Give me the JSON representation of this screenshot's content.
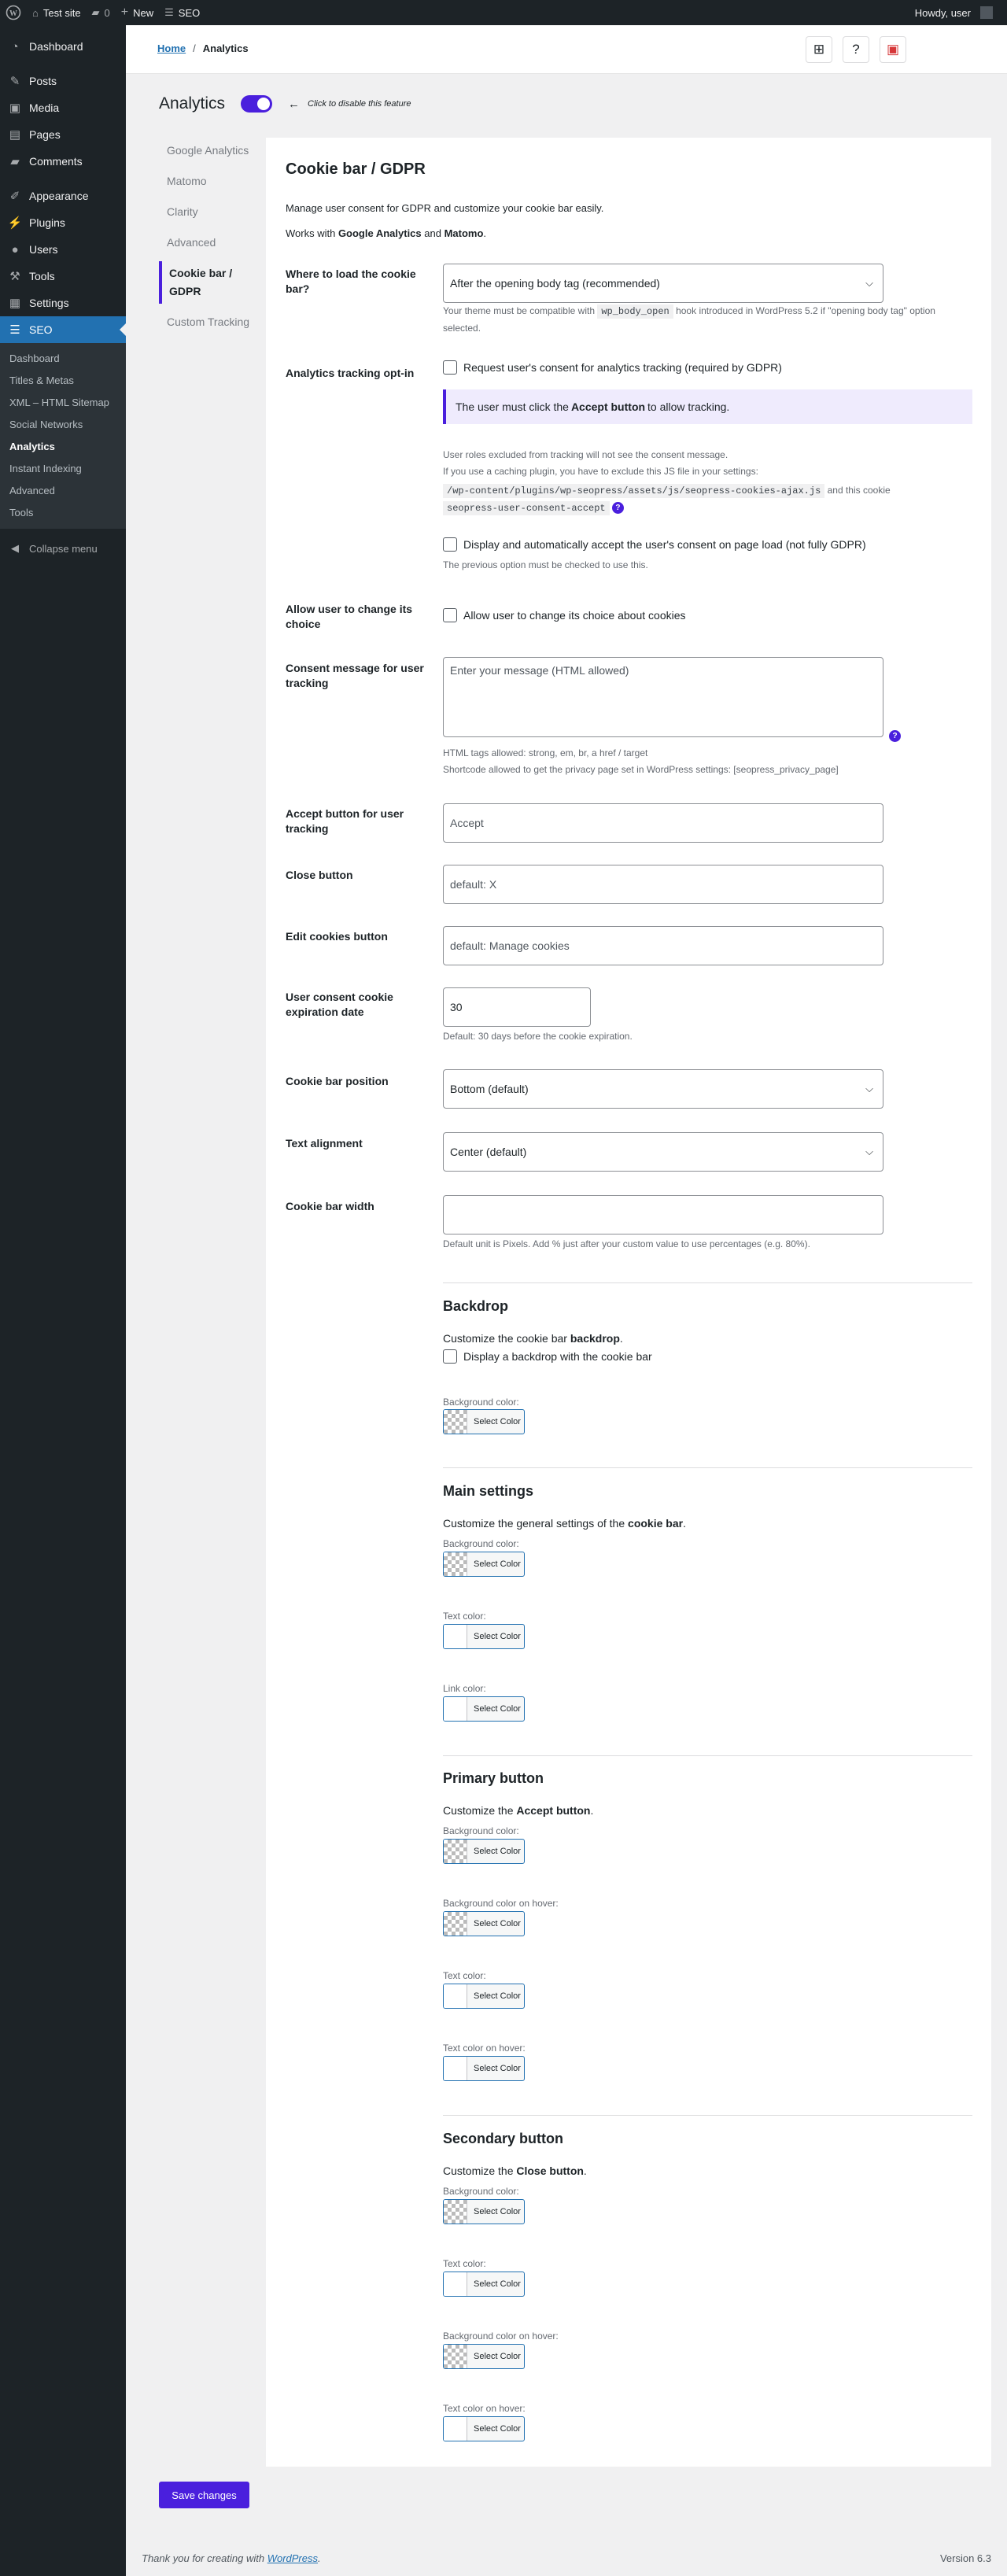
{
  "admin_bar": {
    "site_name": "Test site",
    "comments_count": "0",
    "new_label": "New",
    "seo_label": "SEO",
    "howdy": "Howdy, user"
  },
  "sidebar": {
    "items": [
      {
        "label": "Dashboard",
        "icon": "dashboard-icon"
      },
      {
        "label": "Posts",
        "icon": "pin-icon"
      },
      {
        "label": "Media",
        "icon": "media-icon"
      },
      {
        "label": "Pages",
        "icon": "page-icon"
      },
      {
        "label": "Comments",
        "icon": "comment-icon"
      },
      {
        "label": "Appearance",
        "icon": "brush-icon"
      },
      {
        "label": "Plugins",
        "icon": "plugin-icon"
      },
      {
        "label": "Users",
        "icon": "user-icon"
      },
      {
        "label": "Tools",
        "icon": "wrench-icon"
      },
      {
        "label": "Settings",
        "icon": "settings-icon"
      },
      {
        "label": "SEO",
        "icon": "seo-icon"
      }
    ],
    "seo_submenu": [
      "Dashboard",
      "Titles & Metas",
      "XML – HTML Sitemap",
      "Social Networks",
      "Analytics",
      "Instant Indexing",
      "Advanced",
      "Tools"
    ],
    "collapse": "Collapse menu"
  },
  "breadcrumb": {
    "home": "Home",
    "sep": "/",
    "current": "Analytics"
  },
  "page": {
    "title": "Analytics",
    "toggle_note": "Click to disable this feature"
  },
  "tabs": [
    "Google Analytics",
    "Matomo",
    "Clarity",
    "Advanced",
    "Cookie bar / GDPR",
    "Custom Tracking"
  ],
  "section": {
    "title": "Cookie bar / GDPR",
    "intro": "Manage user consent for GDPR and customize your cookie bar easily.",
    "works_pre": "Works with ",
    "works_ga": "Google Analytics",
    "works_and": " and ",
    "works_matomo": "Matomo",
    "works_end": "."
  },
  "fields": {
    "load": {
      "label": "Where to load the cookie bar?",
      "value": "After the opening body tag (recommended)",
      "desc_pre": "Your theme must be compatible with ",
      "desc_code": "wp_body_open",
      "desc_post": " hook introduced in WordPress 5.2 if \"opening body tag\" option selected."
    },
    "optin": {
      "label": "Analytics tracking opt-in",
      "checkbox": "Request user's consent for analytics tracking (required by GDPR)",
      "notice_pre": "The user must click the ",
      "notice_bold": "Accept button",
      "notice_post": " to allow tracking.",
      "roles": "User roles excluded from tracking will not see the consent message.",
      "cache_pre": "If you use a caching plugin, you have to exclude this JS file in your settings:",
      "cache_code": "/wp-content/plugins/wp-seopress/assets/js/seopress-cookies-ajax.js",
      "cache_mid": " and this cookie",
      "cookie_code": "seopress-user-consent-accept",
      "auto_checkbox": "Display and automatically accept the user's consent on page load (not fully GDPR)",
      "auto_desc": "The previous option must be checked to use this."
    },
    "change": {
      "label": "Allow user to change its choice",
      "checkbox": "Allow user to change its choice about cookies"
    },
    "message": {
      "label": "Consent message for user tracking",
      "placeholder": "Enter your message (HTML allowed)",
      "desc1": "HTML tags allowed: strong, em, br, a href / target",
      "desc2": "Shortcode allowed to get the privacy page set in WordPress settings: [seopress_privacy_page]"
    },
    "accept": {
      "label": "Accept button for user tracking",
      "placeholder": "Accept"
    },
    "close": {
      "label": "Close button",
      "placeholder": "default: X"
    },
    "edit": {
      "label": "Edit cookies button",
      "placeholder": "default: Manage cookies"
    },
    "expiry": {
      "label": "User consent cookie expiration date",
      "value": "30",
      "desc": "Default: 30 days before the cookie expiration."
    },
    "position": {
      "label": "Cookie bar position",
      "value": "Bottom (default)"
    },
    "align": {
      "label": "Text alignment",
      "value": "Center (default)"
    },
    "width": {
      "label": "Cookie bar width",
      "desc": "Default unit is Pixels. Add % just after your custom value to use percentages (e.g. 80%)."
    }
  },
  "backdrop": {
    "title": "Backdrop",
    "desc_pre": "Customize the cookie bar ",
    "desc_bold": "backdrop",
    "desc_end": ".",
    "checkbox": "Display a backdrop with the cookie bar",
    "bg": "Background color:"
  },
  "main": {
    "title": "Main settings",
    "desc_pre": "Customize the general settings of the ",
    "desc_bold": "cookie bar",
    "desc_end": ".",
    "bg": "Background color:",
    "text": "Text color:",
    "link": "Link color:"
  },
  "primary": {
    "title": "Primary button",
    "desc_pre": "Customize the ",
    "desc_bold": "Accept button",
    "desc_end": ".",
    "bg": "Background color:",
    "bg_hover": "Background color on hover:",
    "text": "Text color:",
    "text_hover": "Text color on hover:"
  },
  "secondary": {
    "title": "Secondary button",
    "desc_pre": "Customize the ",
    "desc_bold": "Close button",
    "desc_end": ".",
    "bg": "Background color:",
    "text": "Text color:",
    "bg_hover": "Background color on hover:",
    "text_hover": "Text color on hover:"
  },
  "select_color": "Select Color",
  "save": "Save changes",
  "footer": {
    "pre": "Thank you for creating with ",
    "link": "WordPress",
    "end": ".",
    "version": "Version 6.3"
  },
  "colors": {
    "accent": "#4a1fdd",
    "admin_bg": "#1d2327",
    "active_menu": "#2271b1"
  }
}
